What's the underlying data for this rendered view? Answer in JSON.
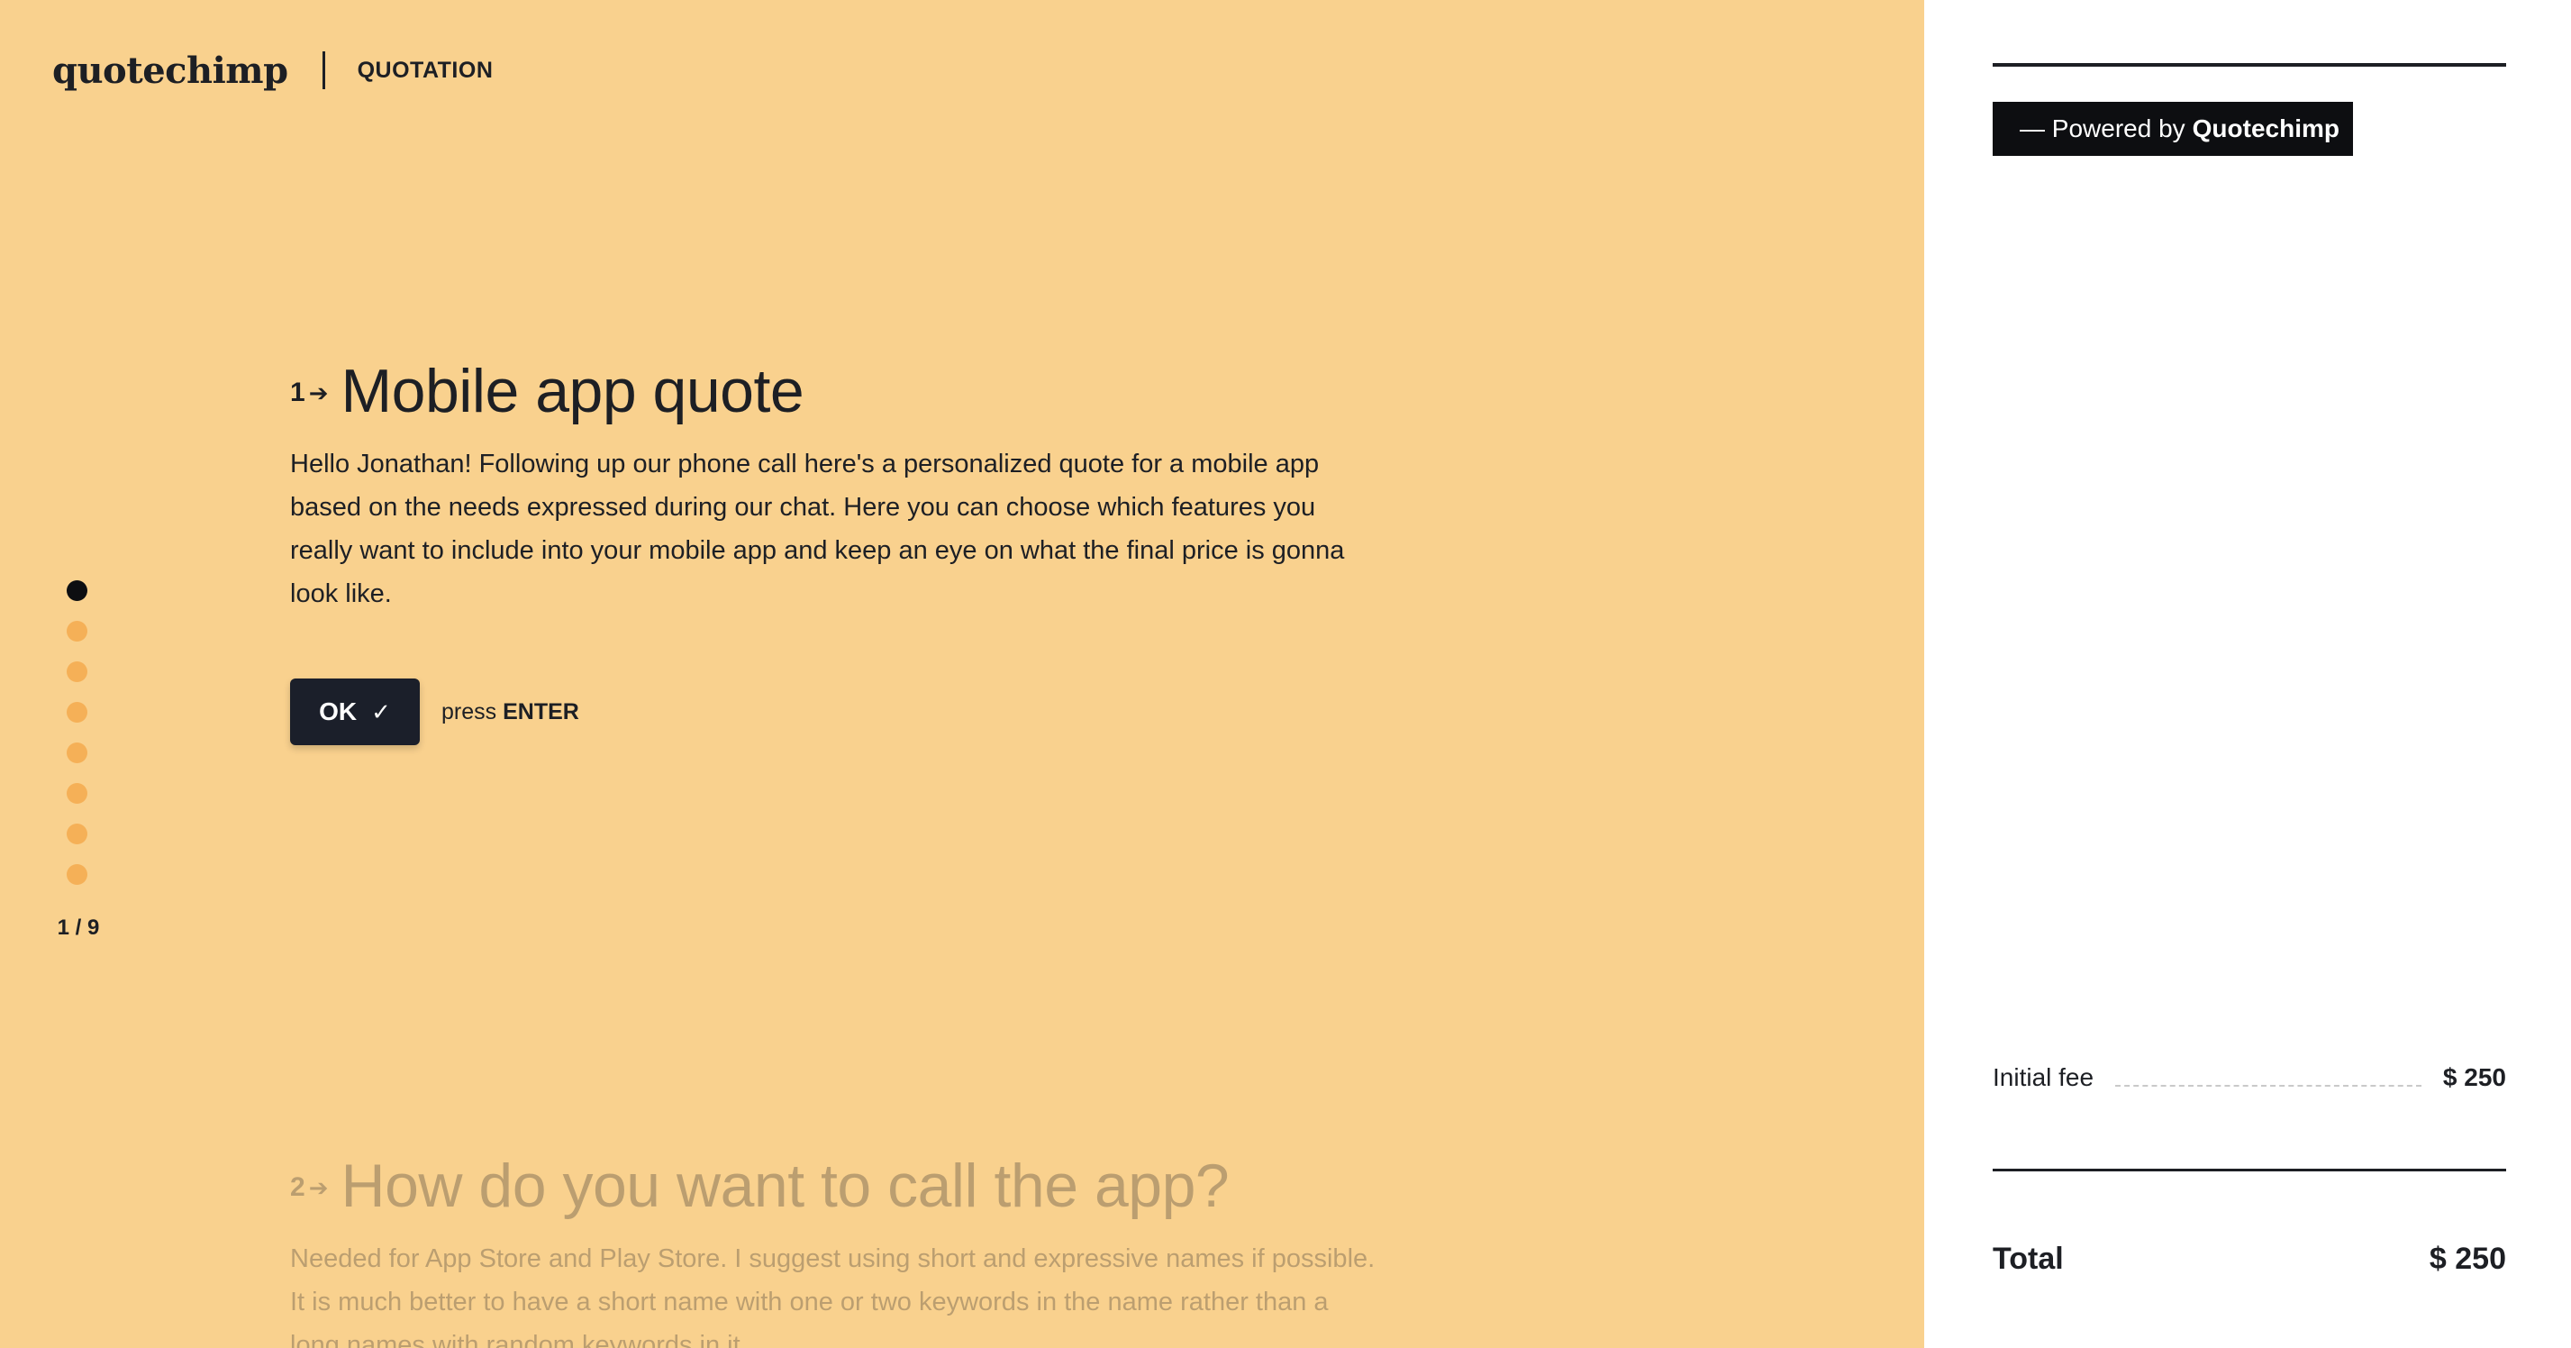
{
  "header": {
    "logo": "quotechimp",
    "tag": "QUOTATION"
  },
  "progress": {
    "total_steps": 9,
    "current_step": 1,
    "counter": "1 / 9"
  },
  "questions": [
    {
      "number": "1",
      "title": "Mobile app quote",
      "description": "Hello Jonathan! Following up our phone call here's a personalized quote for a mobile app based on the needs expressed during our chat. Here you can choose which features you really want to include into your mobile app and keep an eye on what the final price is gonna look like.",
      "ok_label": "OK",
      "press_prefix": "press",
      "press_key": "ENTER"
    },
    {
      "number": "2",
      "title": "How do you want to call the app?",
      "description": "Needed for App Store and Play Store. I suggest using short and expressive names if possible. It is much better to have a short name with one or two keywords in the name rather than a long names with random keywords in it."
    }
  ],
  "sidebar": {
    "powered_prefix": "— Powered by",
    "powered_brand": "Quotechimp",
    "fee_label": "Initial fee",
    "fee_value": "$ 250",
    "total_label": "Total",
    "total_value": "$ 250"
  },
  "colors": {
    "left_background": "#f9d18e",
    "dot_inactive": "#f5b057",
    "dot_active": "#0d0e11",
    "button": "#1b1f2a"
  }
}
